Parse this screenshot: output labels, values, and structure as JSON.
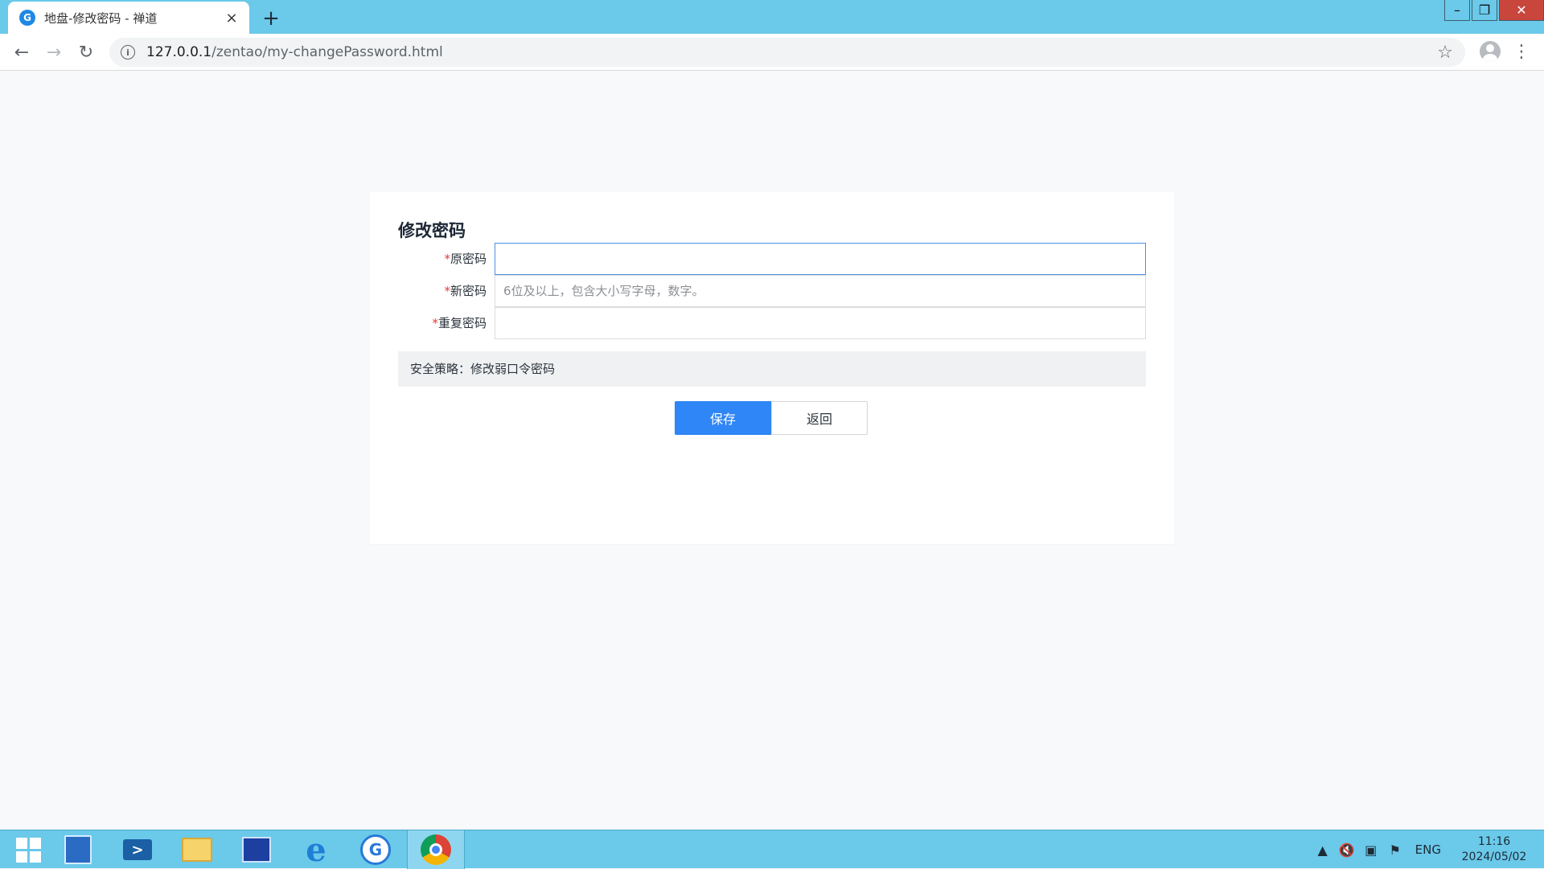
{
  "browser": {
    "tab_title": "地盘-修改密码 - 禅道",
    "tab_close": "×",
    "new_tab": "+",
    "url_host": "127.0.0.1",
    "url_path": "/zentao/my-changePassword.html"
  },
  "window_controls": {
    "minimize": "–",
    "restore": "❐",
    "close": "✕"
  },
  "form": {
    "title": "修改密码",
    "fields": [
      {
        "required_mark": "*",
        "label": "原密码",
        "value": "",
        "placeholder": ""
      },
      {
        "required_mark": "*",
        "label": "新密码",
        "value": "",
        "placeholder": "6位及以上，包含大小写字母，数字。"
      },
      {
        "required_mark": "*",
        "label": "重复密码",
        "value": "",
        "placeholder": ""
      }
    ],
    "policy_text": "安全策略：修改弱口令密码",
    "save_label": "保存",
    "back_label": "返回"
  },
  "taskbar": {
    "lang": "ENG",
    "time": "11:16",
    "date": "2024/05/02"
  },
  "icons": {
    "back": "back-arrow-icon",
    "forward": "forward-arrow-icon",
    "reload": "reload-icon",
    "info": "info-icon",
    "star": "bookmark-star-icon",
    "menu": "menu-dots-icon"
  },
  "colors": {
    "titlebar": "#6bc9ea",
    "primary_button": "#2f86f6",
    "required_mark": "#e53935",
    "close_button": "#c9463d"
  }
}
